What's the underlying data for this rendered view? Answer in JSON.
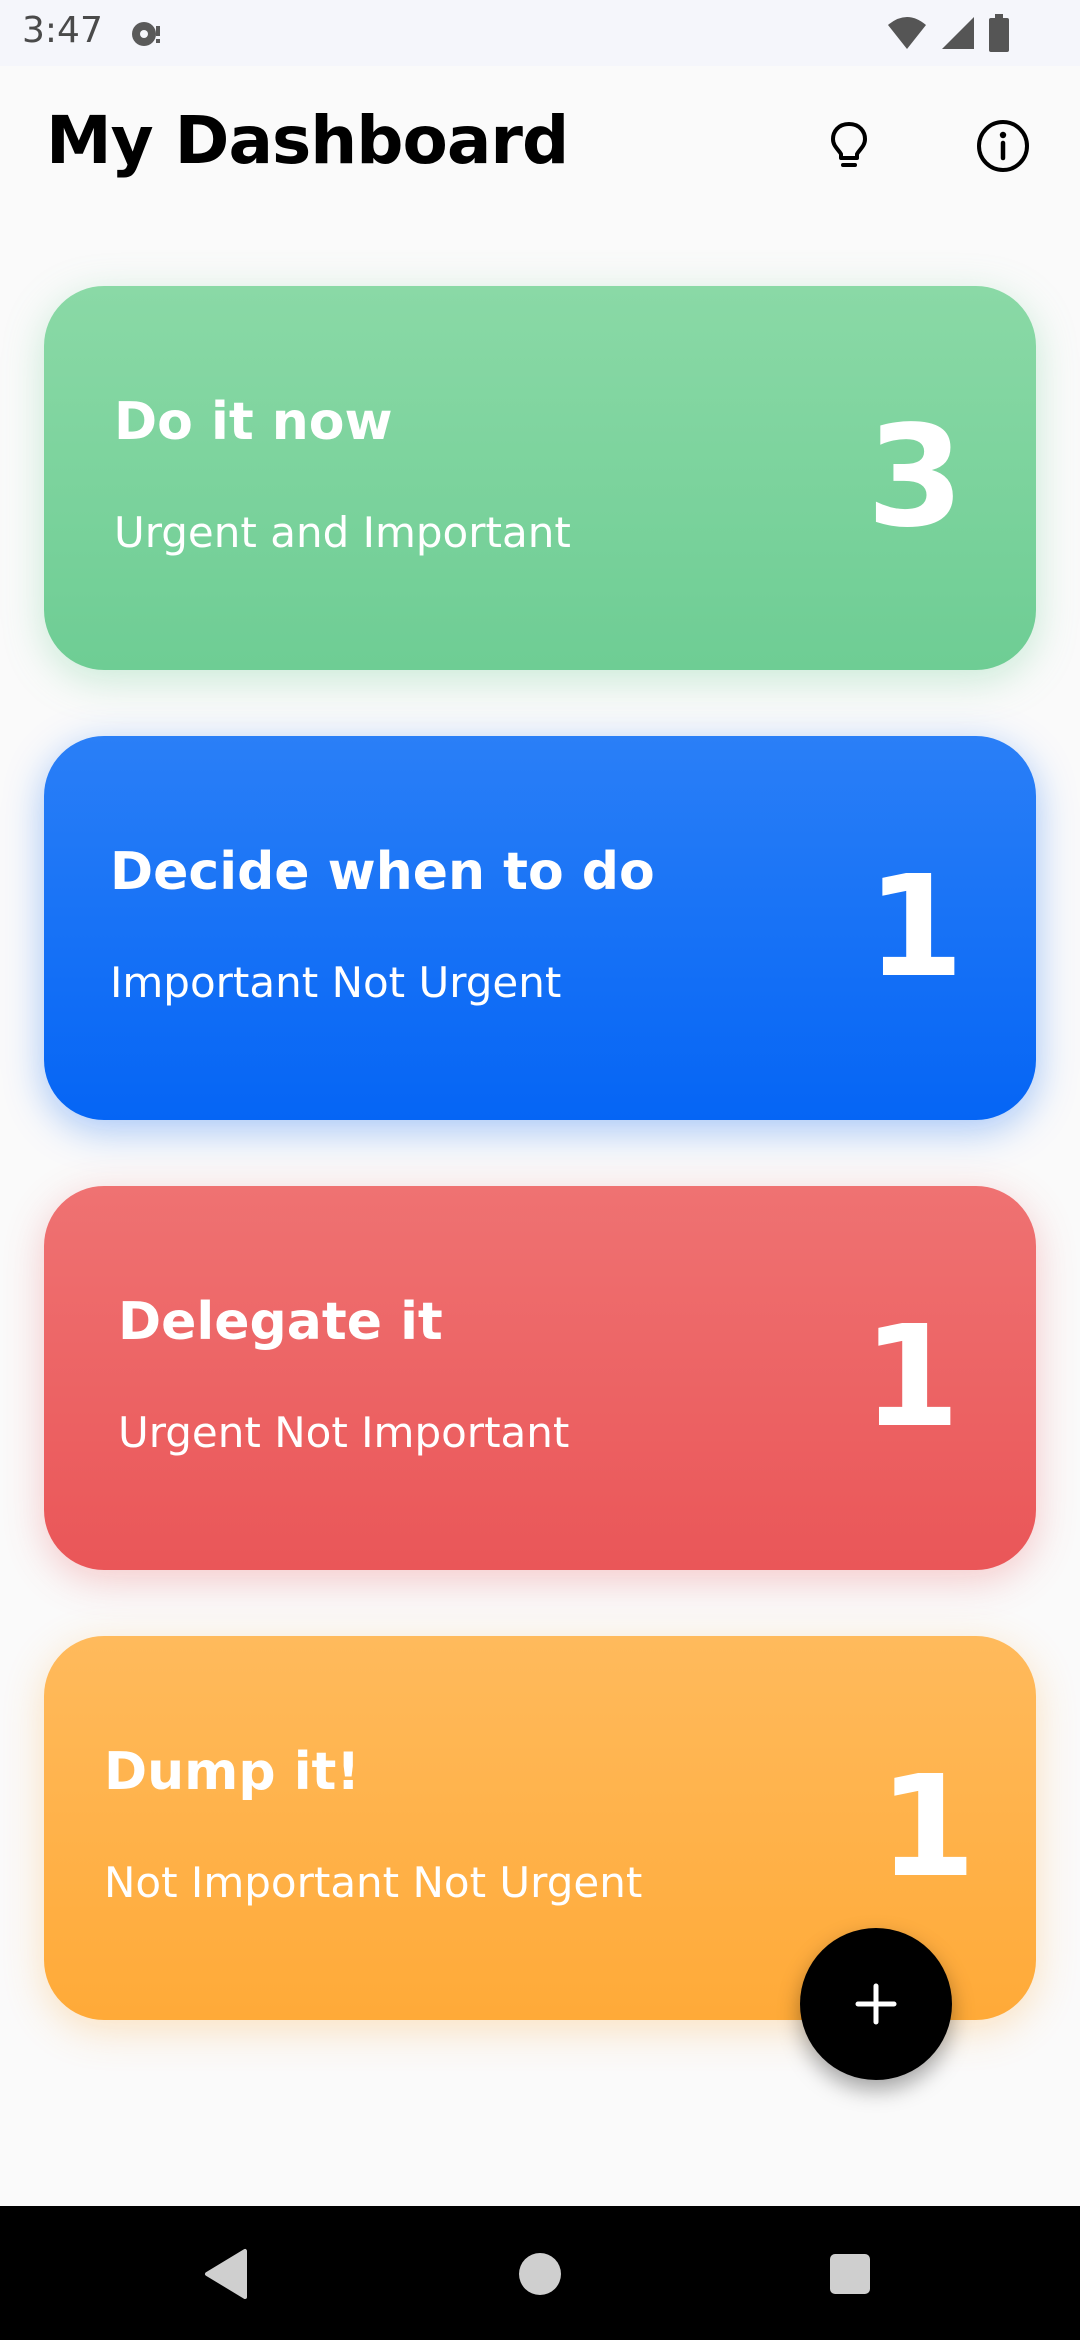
{
  "status_bar": {
    "time": "3:47"
  },
  "header": {
    "title": "My Dashboard",
    "bulb_icon": "lightbulb-icon",
    "info_icon": "info-icon"
  },
  "cards": [
    {
      "title": "Do it now",
      "subtitle": "Urgent and Important",
      "count": "3",
      "color": "#7ad39e"
    },
    {
      "title": "Decide when to do",
      "subtitle": "Important Not Urgent",
      "count": "1",
      "color": "#0a6cf6"
    },
    {
      "title": "Delegate it",
      "subtitle": "Urgent Not Important",
      "count": "1",
      "color": "#ec6063"
    },
    {
      "title": "Dump it!",
      "subtitle": "Not Important Not Urgent",
      "count": "1",
      "color": "#ffb047"
    }
  ],
  "fab": {
    "icon": "plus-icon"
  },
  "nav": {
    "back_icon": "back-triangle-icon",
    "home_icon": "home-circle-icon",
    "recents_icon": "recents-square-icon"
  }
}
